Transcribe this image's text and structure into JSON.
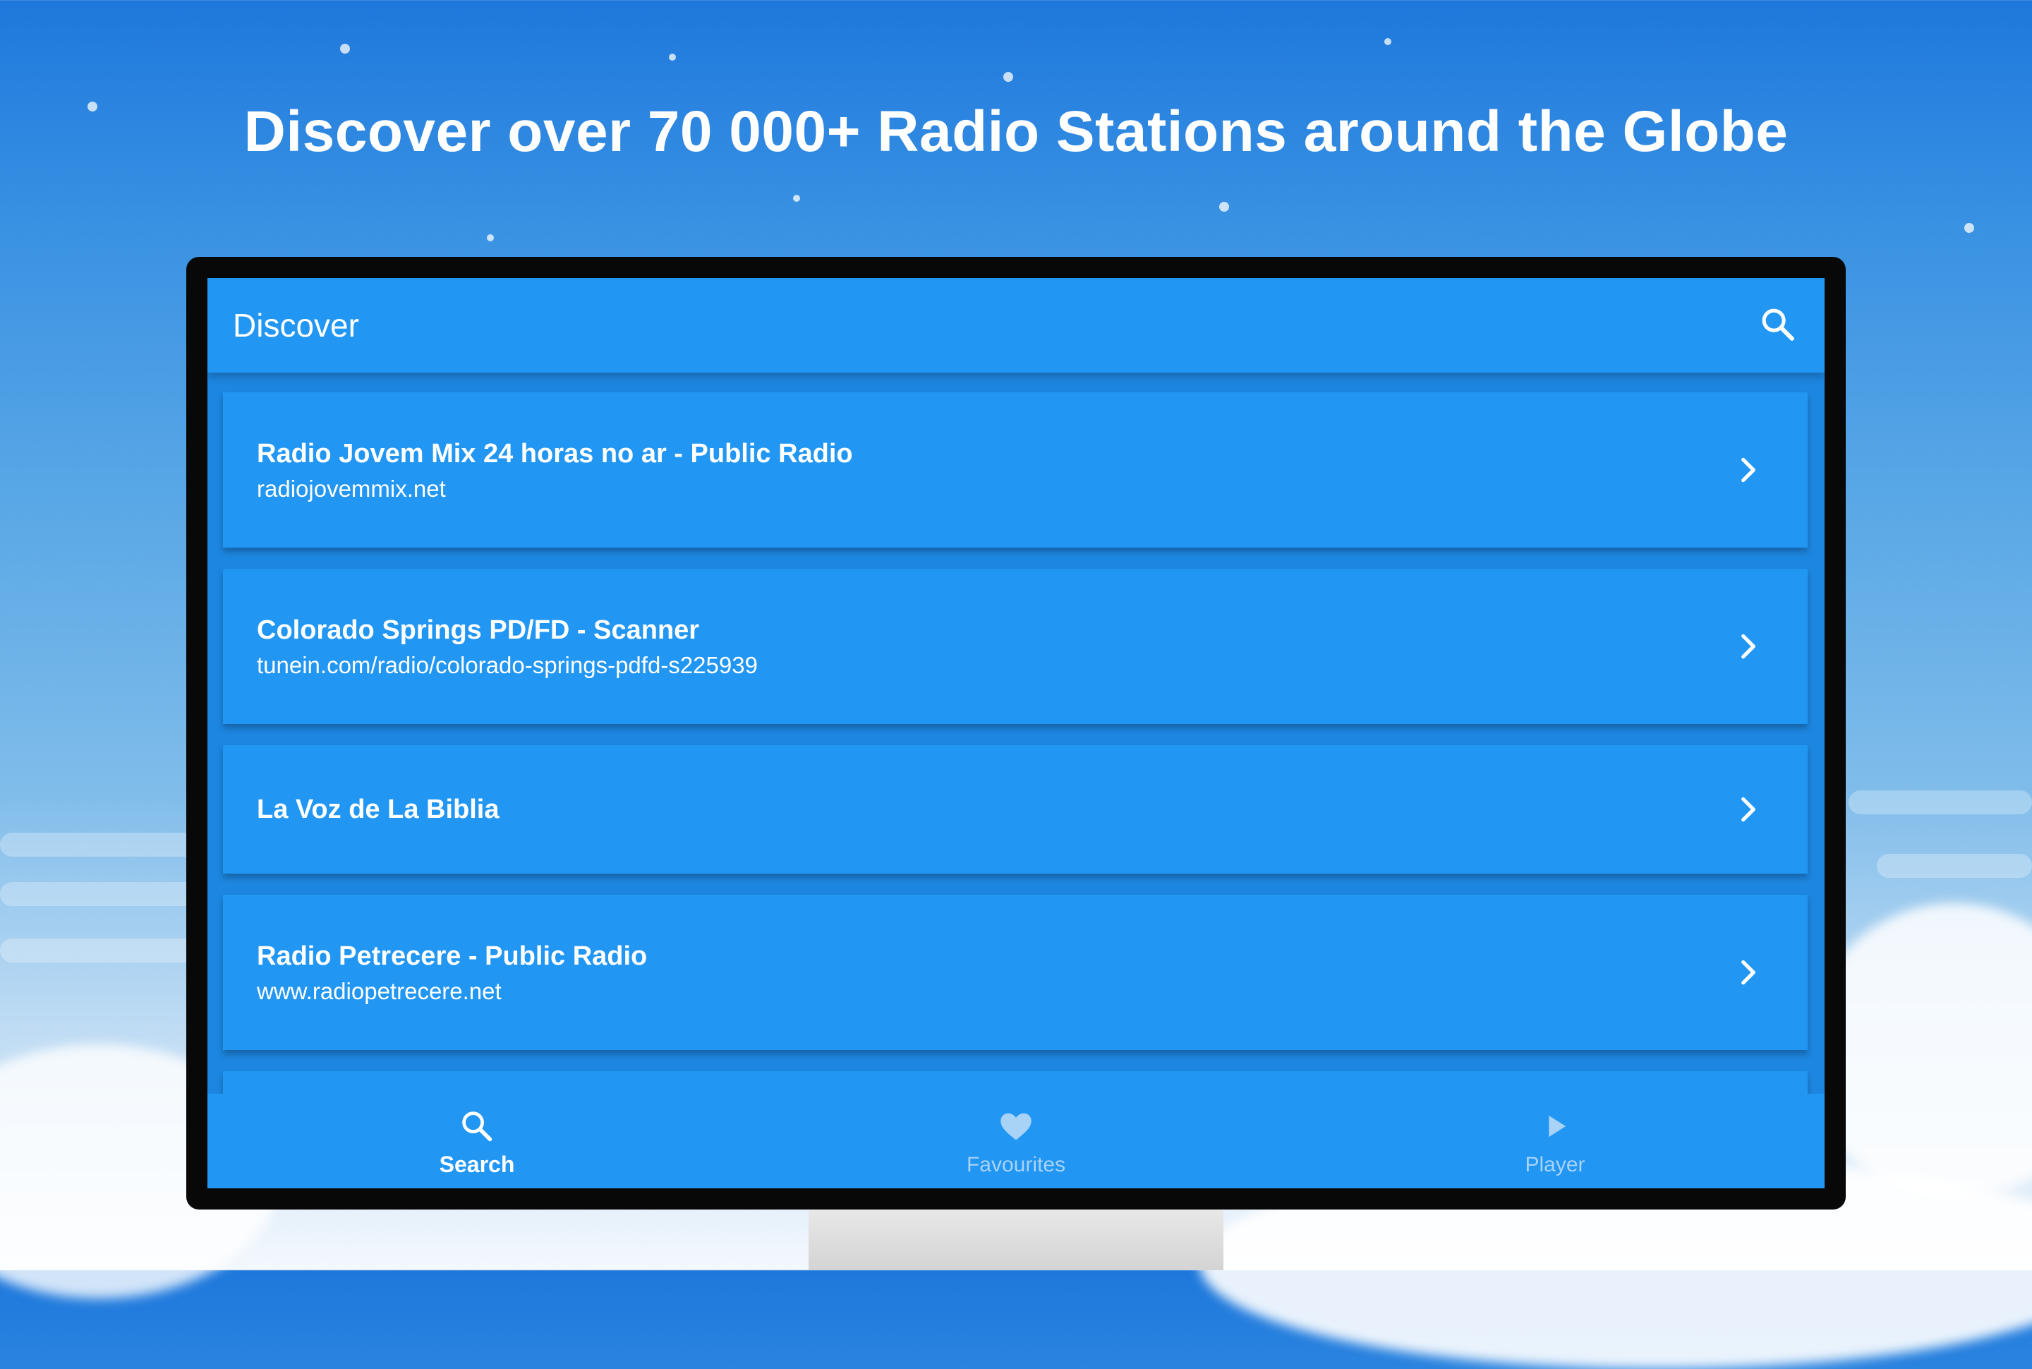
{
  "headline": "Discover over 70 000+ Radio Stations around the Globe",
  "appbar": {
    "title": "Discover",
    "search_icon": "search-icon"
  },
  "stations": [
    {
      "title": "Radio Jovem Mix 24 horas no ar - Public Radio",
      "subtitle": "radiojovemmix.net"
    },
    {
      "title": "Colorado Springs PD/FD - Scanner",
      "subtitle": "tunein.com/radio/colorado-springs-pdfd-s225939"
    },
    {
      "title": "La Voz de La Biblia",
      "subtitle": ""
    },
    {
      "title": "Radio Petrecere - Public Radio",
      "subtitle": "www.radiopetrecere.net"
    }
  ],
  "bottom_nav": [
    {
      "label": "Search",
      "icon": "search-icon",
      "active": true
    },
    {
      "label": "Favourites",
      "icon": "heart-icon",
      "active": false
    },
    {
      "label": "Player",
      "icon": "play-icon",
      "active": false
    }
  ],
  "colors": {
    "primary": "#2196f3",
    "screen_bg": "#1d86e0",
    "inactive_tab": "#a9d2f7",
    "bezel": "#080808"
  }
}
